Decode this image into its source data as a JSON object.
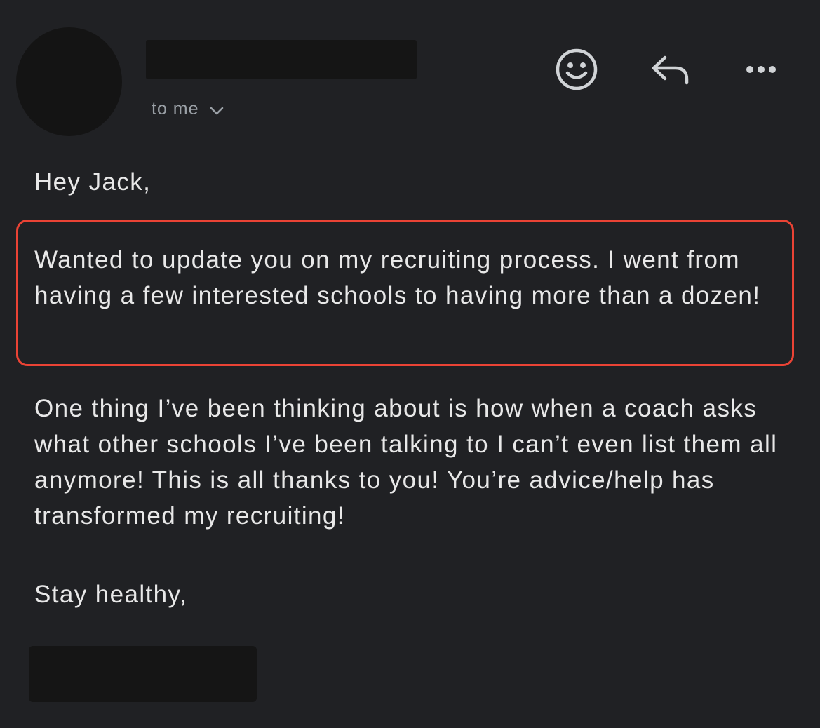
{
  "header": {
    "recipient_label": "to me",
    "icons": {
      "expand": "chevron-down-icon",
      "emoji": "smiley-icon",
      "reply": "reply-icon",
      "more": "more-horizontal-icon"
    }
  },
  "message": {
    "greeting": "Hey Jack,",
    "highlighted_paragraph": "Wanted to update you on my recruiting process. I went from having a few interested schools to having more than a dozen!",
    "paragraph": "One thing I’ve been thinking about is how when a coach asks what other schools I’ve been talking to I can’t even list them all anymore! This is all thanks to you! You’re advice/help has transformed my recruiting!",
    "signoff": "Stay healthy,"
  },
  "colors": {
    "background": "#202124",
    "text": "#e8e8e8",
    "secondary_text": "#9aa0a6",
    "highlight_border": "#ea4335",
    "redaction": "#151515"
  }
}
